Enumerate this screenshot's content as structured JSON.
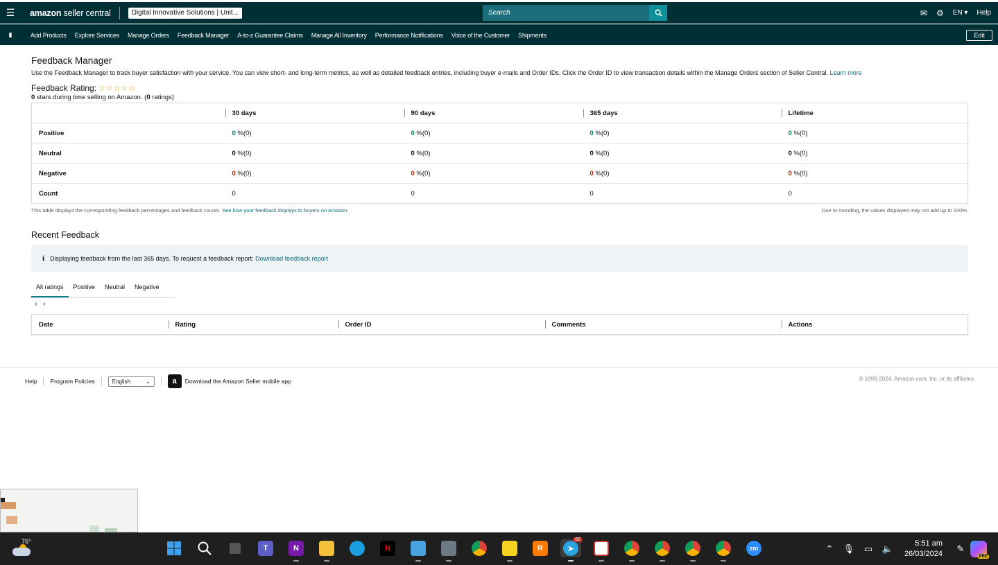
{
  "header": {
    "logo_bold": "amazon",
    "logo_rest": " seller central",
    "account": "Digital Innovative Solutions | Unit...",
    "search_placeholder": "Search",
    "language": "EN ▾",
    "help": "Help"
  },
  "nav": {
    "items": [
      "Add Products",
      "Explore Services",
      "Manage Orders",
      "Feedback Manager",
      "A-to-z Guarantee Claims",
      "Manage All Inventory",
      "Performance Notifications",
      "Voice of the Customer",
      "Shipments"
    ],
    "edit": "Edit"
  },
  "page": {
    "title": "Feedback Manager",
    "intro": "Use the Feedback Manager to track buyer satisfaction with your service. You can view short- and long-term metrics, as well as detailed feedback entries, including buyer e-mails and Order IDs. Click the Order ID to view transaction details within the Manage Orders section of Seller Central.",
    "learn_more": "Learn more",
    "rating_label": "Feedback Rating:",
    "stars": "☆☆☆☆☆",
    "stars_count": "0",
    "stars_text": " stars during time selling on Amazon. (",
    "ratings_count": "0",
    "ratings_text": " ratings)"
  },
  "feedback_table": {
    "columns": [
      "30 days",
      "90 days",
      "365 days",
      "Lifetime"
    ],
    "rows": [
      {
        "label": "Positive",
        "values": [
          "0",
          "0",
          "0",
          "0"
        ],
        "suffix": " %(0)"
      },
      {
        "label": "Neutral",
        "values": [
          "0",
          "0",
          "0",
          "0"
        ],
        "suffix": " %(0)"
      },
      {
        "label": "Negative",
        "values": [
          "0",
          "0",
          "0",
          "0"
        ],
        "suffix": " %(0)"
      },
      {
        "label": "Count",
        "values": [
          "0",
          "0",
          "0",
          "0"
        ],
        "suffix": ""
      }
    ],
    "note_left": "This table displays the corresponding feedback percentages and feedback counts.",
    "note_link": "See how your feedback displays to buyers on Amazon.",
    "note_right": "Due to rounding, the values displayed may not add up to 100%."
  },
  "recent": {
    "title": "Recent Feedback",
    "info_icon": "i",
    "info_text": "Displaying feedback from the last 365 days. To request a feedback report:",
    "info_link": "Download feedback report",
    "tabs": [
      "All ratings",
      "Positive",
      "Neutral",
      "Negative"
    ],
    "prev": "‹",
    "next": "›",
    "columns": [
      "Date",
      "Rating",
      "Order ID",
      "Comments",
      "Actions"
    ]
  },
  "footer": {
    "help": "Help",
    "policies": "Program Policies",
    "language": "English",
    "app_text": "Download the Amazon Seller mobile app",
    "copyright": "© 1999-2024, Amazon.com, Inc. or its affiliates"
  },
  "taskbar": {
    "temperature": "76°",
    "telegram_badge": "82",
    "time": "5:51 am",
    "date": "26/03/2024",
    "copilot_badge": "PRE"
  },
  "colors": {
    "header_bg": "#002f36",
    "positive": "#067d62",
    "negative": "#b12704",
    "link": "#0e6c7a"
  }
}
